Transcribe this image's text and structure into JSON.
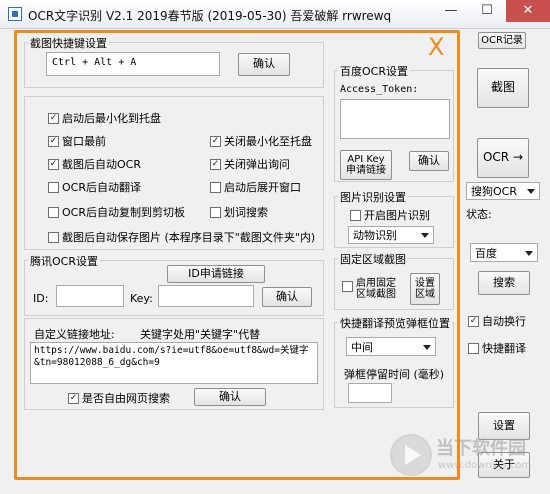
{
  "window": {
    "title": "OCR文字识别 V2.1   2019春节版 (2019-05-30)   吾爱破解 rrwrewq",
    "controls": {
      "minimize": "—",
      "maximize": "☐",
      "close": "✕"
    }
  },
  "screenshot_hotkey": {
    "label": "截图快捷键设置",
    "value": "Ctrl + Alt + A",
    "confirm": "确认"
  },
  "options": {
    "items": [
      {
        "label": "启动后最小化到托盘",
        "checked": true
      },
      {
        "label": "窗口最前",
        "checked": true
      },
      {
        "label": "关闭最小化至托盘",
        "checked": true
      },
      {
        "label": "截图后自动OCR",
        "checked": true
      },
      {
        "label": "关闭弹出询问",
        "checked": true
      },
      {
        "label": "OCR后自动翻译",
        "checked": false
      },
      {
        "label": "启动后展开窗口",
        "checked": false
      },
      {
        "label": "OCR后自动复制到剪切板",
        "checked": false
      },
      {
        "label": "划词搜索",
        "checked": false
      },
      {
        "label": "截图后自动保存图片 (本程序目录下\"截图文件夹\"内)",
        "checked": false
      }
    ]
  },
  "tencent": {
    "label": "腾讯OCR设置",
    "apply_link": "ID申请链接",
    "id_label": "ID:",
    "key_label": "Key:",
    "confirm": "确认"
  },
  "custom_link": {
    "label": "自定义链接地址:",
    "hint": "关键字处用\"关键字\"代替",
    "url": "https://www.baidu.com/s?ie=utf8&oe=utf8&wd=关键字&tn=98012088_6_dg&ch=9",
    "web_search": {
      "label": "是否自由网页搜索",
      "checked": true
    },
    "confirm": "确认"
  },
  "baidu": {
    "label": "百度OCR设置",
    "token_label": "Access_Token:",
    "apply_link": "API Key 申请链接",
    "confirm": "确认"
  },
  "image_recognition": {
    "label": "图片识别设置",
    "enable": {
      "label": "开启图片识别",
      "checked": false
    },
    "mode": "动物识别"
  },
  "fixed_region": {
    "label": "固定区域截图",
    "enable": {
      "label": "启用固定区域截图",
      "checked": false
    },
    "set_button": "设置区域"
  },
  "preview": {
    "label": "快捷翻译预览弹框位置",
    "position": "中间",
    "stay_label": "弹框停留时间 (毫秒)",
    "stay_value": ""
  },
  "side": {
    "ocr_record": "OCR记录",
    "screenshot": "截图",
    "ocr_arrow": "OCR →",
    "engine": "搜狗OCR",
    "status_label": "状态:",
    "search_engine": "百度",
    "search": "搜索",
    "auto_wrap": {
      "label": "自动换行",
      "checked": true
    },
    "quick_translate": {
      "label": "快捷翻译",
      "checked": false
    },
    "settings": "设置",
    "about": "关于"
  },
  "overlay": {
    "mark": "X",
    "color": "#f08a1c"
  },
  "watermark": {
    "text": "当下软件园",
    "url": "www.downxia.com"
  }
}
